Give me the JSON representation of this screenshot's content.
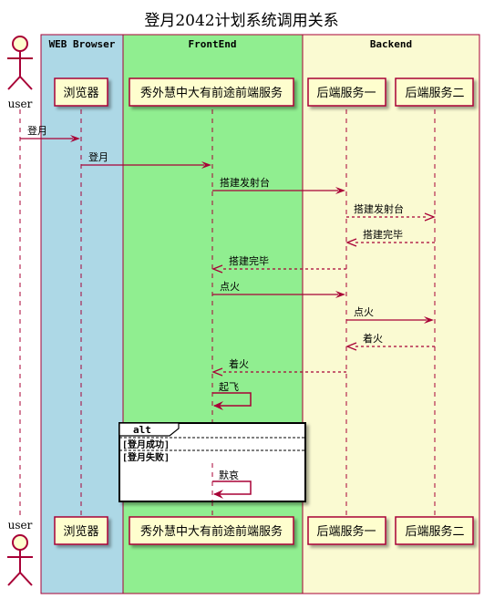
{
  "title": "登月2042计划系统调用关系",
  "boxes": [
    {
      "key": "web",
      "label": "WEB Browser",
      "color": "#ADD8E6"
    },
    {
      "key": "frontend",
      "label": "FrontEnd",
      "color": "#90EE90"
    },
    {
      "key": "backend",
      "label": "Backend",
      "color": "#FAFAD2"
    }
  ],
  "participants": [
    {
      "key": "user",
      "label": "user",
      "kind": "actor"
    },
    {
      "key": "browser",
      "label": "浏览器",
      "kind": "participant"
    },
    {
      "key": "frontend",
      "label": "秀外慧中大有前途前端服务",
      "kind": "participant"
    },
    {
      "key": "backend1",
      "label": "后端服务一",
      "kind": "participant"
    },
    {
      "key": "backend2",
      "label": "后端服务二",
      "kind": "participant"
    }
  ],
  "messages": [
    {
      "from": "user",
      "to": "browser",
      "label": "登月",
      "style": "solid"
    },
    {
      "from": "browser",
      "to": "frontend",
      "label": "登月",
      "style": "solid"
    },
    {
      "from": "frontend",
      "to": "backend1",
      "label": "搭建发射台",
      "style": "solid"
    },
    {
      "from": "backend1",
      "to": "backend2",
      "label": "搭建发射台",
      "style": "dashed"
    },
    {
      "from": "backend2",
      "to": "backend1",
      "label": "搭建完毕",
      "style": "dashed"
    },
    {
      "from": "backend1",
      "to": "frontend",
      "label": "搭建完毕",
      "style": "dashed"
    },
    {
      "from": "frontend",
      "to": "backend1",
      "label": "点火",
      "style": "solid"
    },
    {
      "from": "backend1",
      "to": "backend2",
      "label": "点火",
      "style": "solid"
    },
    {
      "from": "backend2",
      "to": "backend1",
      "label": "着火",
      "style": "dashed"
    },
    {
      "from": "backend1",
      "to": "frontend",
      "label": "着火",
      "style": "dashed"
    },
    {
      "from": "frontend",
      "to": "frontend",
      "label": "起飞",
      "style": "self"
    }
  ],
  "alt": {
    "keyword": "alt",
    "branches": [
      {
        "guard": "[登月成功]"
      },
      {
        "guard": "[登月失败]",
        "message": {
          "from": "frontend",
          "to": "frontend",
          "label": "默哀",
          "style": "self"
        }
      }
    ]
  },
  "colors": {
    "line": "#A80036",
    "participant_fill": "#FEFECE",
    "text": "#000000"
  }
}
